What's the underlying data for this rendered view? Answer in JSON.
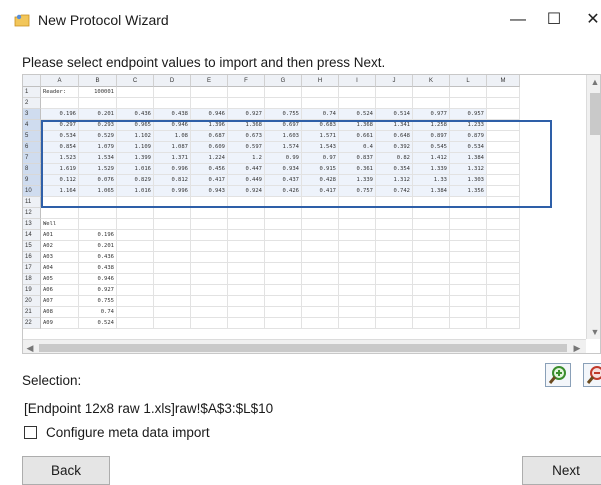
{
  "window": {
    "title": "New Protocol Wizard",
    "minimize_glyph": "—",
    "maximize_glyph": "☐",
    "close_glyph": "✕"
  },
  "instruction": "Please select endpoint values to import and then press Next.",
  "sheet": {
    "columns": [
      "A",
      "B",
      "C",
      "D",
      "E",
      "F",
      "G",
      "H",
      "I",
      "J",
      "K",
      "L",
      "M"
    ],
    "row_numbers": [
      "1",
      "2",
      "3",
      "4",
      "5",
      "6",
      "7",
      "8",
      "9",
      "10",
      "11",
      "12",
      "13",
      "14",
      "15",
      "16",
      "17",
      "18",
      "19",
      "20",
      "21",
      "22"
    ],
    "rows": [
      [
        "Reader:",
        "100001",
        "",
        "",
        "",
        "",
        "",
        "",
        "",
        "",
        "",
        "",
        ""
      ],
      [
        "",
        "",
        "",
        "",
        "",
        "",
        "",
        "",
        "",
        "",
        "",
        "",
        ""
      ],
      [
        "0.196",
        "0.201",
        "0.436",
        "0.438",
        "0.946",
        "0.927",
        "0.755",
        "0.74",
        "0.524",
        "0.514",
        "0.977",
        "0.957",
        ""
      ],
      [
        "0.297",
        "0.293",
        "0.965",
        "0.946",
        "1.396",
        "1.368",
        "0.697",
        "0.683",
        "1.368",
        "1.341",
        "1.258",
        "1.233",
        ""
      ],
      [
        "0.534",
        "0.529",
        "1.102",
        "1.08",
        "0.687",
        "0.673",
        "1.603",
        "1.571",
        "0.661",
        "0.648",
        "0.897",
        "0.879",
        ""
      ],
      [
        "0.854",
        "1.079",
        "1.109",
        "1.087",
        "0.609",
        "0.597",
        "1.574",
        "1.543",
        "0.4",
        "0.392",
        "0.545",
        "0.534",
        ""
      ],
      [
        "1.523",
        "1.534",
        "1.399",
        "1.371",
        "1.224",
        "1.2",
        "0.99",
        "0.97",
        "0.837",
        "0.82",
        "1.412",
        "1.384",
        ""
      ],
      [
        "1.619",
        "1.529",
        "1.016",
        "0.996",
        "0.456",
        "0.447",
        "0.934",
        "0.915",
        "0.361",
        "0.354",
        "1.339",
        "1.312",
        ""
      ],
      [
        "0.112",
        "0.076",
        "0.829",
        "0.812",
        "0.417",
        "0.449",
        "0.437",
        "0.428",
        "1.339",
        "1.312",
        "1.33",
        "1.303",
        ""
      ],
      [
        "1.164",
        "1.065",
        "1.016",
        "0.996",
        "0.943",
        "0.924",
        "0.426",
        "0.417",
        "0.757",
        "0.742",
        "1.384",
        "1.356",
        ""
      ],
      [
        "",
        "",
        "",
        "",
        "",
        "",
        "",
        "",
        "",
        "",
        "",
        "",
        ""
      ],
      [
        "",
        "",
        "",
        "",
        "",
        "",
        "",
        "",
        "",
        "",
        "",
        "",
        ""
      ],
      [
        "Well",
        "",
        "",
        "",
        "",
        "",
        "",
        "",
        "",
        "",
        "",
        "",
        ""
      ],
      [
        "A01",
        "0.196",
        "",
        "",
        "",
        "",
        "",
        "",
        "",
        "",
        "",
        "",
        ""
      ],
      [
        "A02",
        "0.201",
        "",
        "",
        "",
        "",
        "",
        "",
        "",
        "",
        "",
        "",
        ""
      ],
      [
        "A03",
        "0.436",
        "",
        "",
        "",
        "",
        "",
        "",
        "",
        "",
        "",
        "",
        ""
      ],
      [
        "A04",
        "0.438",
        "",
        "",
        "",
        "",
        "",
        "",
        "",
        "",
        "",
        "",
        ""
      ],
      [
        "A05",
        "0.946",
        "",
        "",
        "",
        "",
        "",
        "",
        "",
        "",
        "",
        "",
        ""
      ],
      [
        "A06",
        "0.927",
        "",
        "",
        "",
        "",
        "",
        "",
        "",
        "",
        "",
        "",
        ""
      ],
      [
        "A07",
        "0.755",
        "",
        "",
        "",
        "",
        "",
        "",
        "",
        "",
        "",
        "",
        ""
      ],
      [
        "A08",
        "0.74",
        "",
        "",
        "",
        "",
        "",
        "",
        "",
        "",
        "",
        "",
        ""
      ],
      [
        "A09",
        "0.524",
        "",
        "",
        "",
        "",
        "",
        "",
        "",
        "",
        "",
        "",
        ""
      ]
    ],
    "selected_rows": [
      3,
      4,
      5,
      6,
      7,
      8,
      9,
      10
    ],
    "selection_color": "#2e5fa8"
  },
  "zoom": {
    "in_icon": "magnify-plus-icon",
    "out_icon": "magnify-minus-icon"
  },
  "selection": {
    "label": "Selection:",
    "value": "[Endpoint 12x8 raw 1.xls]raw!$A$3:$L$10"
  },
  "meta": {
    "label": "Configure meta data import",
    "checked": false
  },
  "buttons": {
    "back": "Back",
    "next": "Next"
  }
}
